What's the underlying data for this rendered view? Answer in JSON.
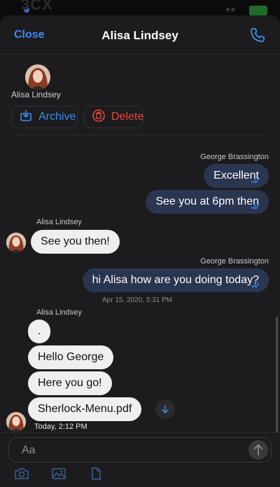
{
  "status": {
    "brand_text": "3CX"
  },
  "nav": {
    "close_label": "Close",
    "title": "Alisa Lindsey"
  },
  "contact": {
    "name": "Alisa Lindsey",
    "archive_label": "Archive",
    "delete_label": "Delete"
  },
  "messages": [
    {
      "sender": "George Brassington",
      "direction": "out",
      "bubbles": [
        "Excellent",
        "See you at 6pm then"
      ]
    },
    {
      "sender": "Alisa Lindsey",
      "direction": "in",
      "bubbles": [
        "See you then!"
      ]
    },
    {
      "sender": "George Brassington",
      "direction": "out",
      "bubbles": [
        "hi Alisa how are you doing today?"
      ],
      "timestamp": "Apr 15, 2020, 5:31 PM"
    },
    {
      "sender": "Alisa Lindsey",
      "direction": "in",
      "bubbles": [
        ".",
        "Hello George",
        "Here you go!",
        "Sherlock-Menu.pdf"
      ],
      "timestamp": "Today, 2:12 PM"
    }
  ],
  "composer": {
    "placeholder": "Aa"
  },
  "icons": {
    "phone": "phone-icon",
    "archive": "archive-icon",
    "delete": "trash-icon",
    "download": "download-icon",
    "send": "send-arrow-icon",
    "camera": "camera-icon",
    "image": "image-icon",
    "file": "file-icon"
  },
  "colors": {
    "accent": "#3b8cf0",
    "danger": "#e2463c",
    "outgoing_bubble": "#2a3550",
    "incoming_bubble": "#efefef",
    "background": "#1c1c1e"
  }
}
